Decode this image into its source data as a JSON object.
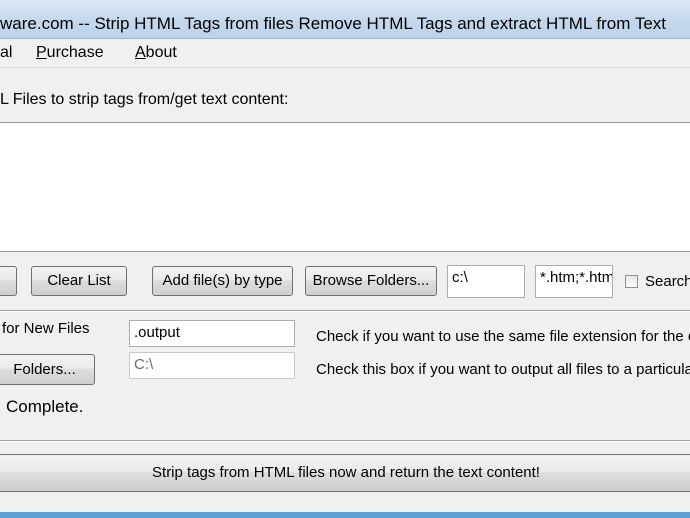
{
  "window": {
    "title": "ware.com -- Strip HTML Tags from files Remove HTML Tags and extract HTML from Text"
  },
  "menu": {
    "items": [
      {
        "label": "al"
      },
      {
        "label": "Purchase",
        "accel": "P",
        "rest": "urchase"
      },
      {
        "label": "About",
        "accel": "A",
        "rest": "bout"
      }
    ]
  },
  "files": {
    "prompt": "L Files to strip tags from/get text content:"
  },
  "toolbar": {
    "clear_label": "Clear List",
    "add_by_type_label": "Add file(s) by type",
    "browse_label": "Browse Folders...",
    "path_value": "c:\\",
    "filter_value": "*.htm;*.htm",
    "search_label": "Search"
  },
  "output": {
    "new_files_label": "for New Files",
    "extension_value": ".output",
    "extension_check_label": "Check if you want to use the same file extension for the ou",
    "folders_button_label": "Folders...",
    "folder_placeholder": "C:\\",
    "folder_check_label": "Check this box if you want to output all files to a particular"
  },
  "status": {
    "text": "Complete."
  },
  "action": {
    "run_label": "Strip tags from HTML files now and return the text content!"
  }
}
